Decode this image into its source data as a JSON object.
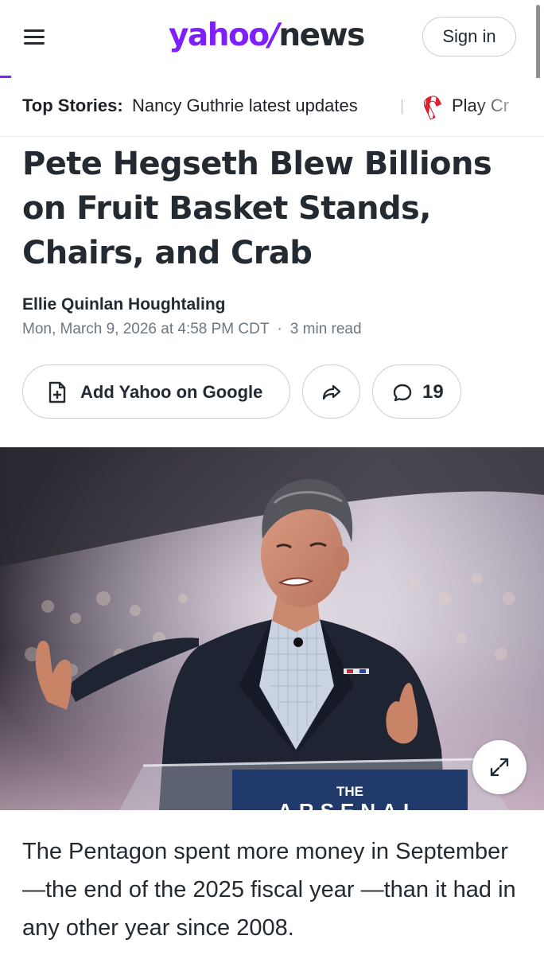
{
  "header": {
    "logo_yahoo": "yahoo",
    "logo_bang": "/",
    "logo_news": "news",
    "signin_label": "Sign in",
    "brand_color": "#7e1fff"
  },
  "ticker": {
    "label": "Top Stories:",
    "link": "Nancy Guthrie latest updates",
    "play_link": "Play Cr"
  },
  "article": {
    "title": "Pete Hegseth Blew Billions on Fruit Basket Stands, Chairs, and Crab",
    "author": "Ellie Quinlan Houghtaling",
    "date": "Mon, March 9, 2026 at 4:58 PM CDT",
    "read_time": "3 min read",
    "body_first": "The Pentagon spent more money in September—the end of the 2025 fiscal year —than it had in any other year since 2008."
  },
  "actions": {
    "add_google_label": "Add Yahoo on Google",
    "comment_count": "19"
  },
  "hero": {
    "podium_text": "THE",
    "podium_text_2": "ARSENAL"
  },
  "icons": {
    "menu": "menu-icon",
    "add_google": "document-plus-icon",
    "share": "share-arrow-icon",
    "comment": "comment-bubble-icon",
    "expand": "expand-arrows-icon",
    "candy": "candy-cane-icon"
  }
}
